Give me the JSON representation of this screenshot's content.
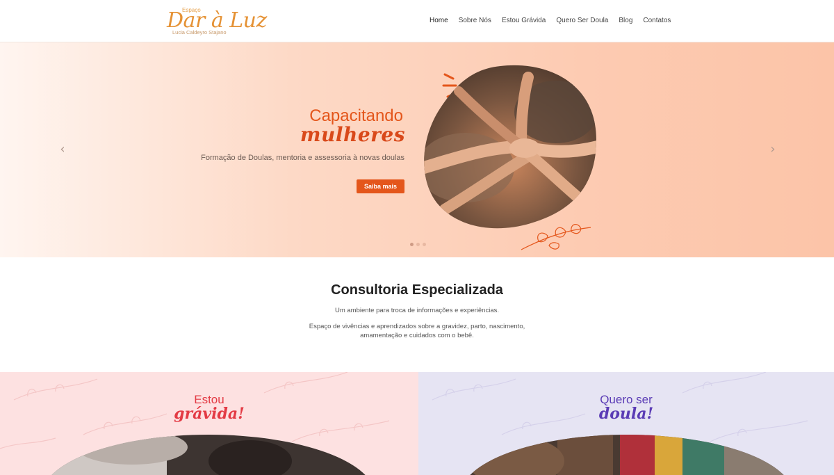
{
  "header": {
    "logo": {
      "small": "Espaço",
      "script": "Dar à Luz",
      "sub": "Lucia Caldeyro Stajano"
    },
    "nav": [
      {
        "label": "Home",
        "active": true
      },
      {
        "label": "Sobre Nós"
      },
      {
        "label": "Estou Grávida"
      },
      {
        "label": "Quero Ser Doula"
      },
      {
        "label": "Blog"
      },
      {
        "label": "Contatos"
      }
    ]
  },
  "hero": {
    "title": "Capacitando",
    "script": "mulheres",
    "description": "Formação de Doulas, mentoria e assessoria à novas doulas",
    "button": "Saiba mais",
    "prev_icon": "chevron-left-icon",
    "next_icon": "chevron-right-icon",
    "slides_total": 3,
    "active_slide": 1,
    "image": "hands-holding-photo"
  },
  "consultoria": {
    "title": "Consultoria Especializada",
    "p1": "Um ambiente para troca de informações e experiências.",
    "p2": "Espaço de vivências e aprendizados sobre a gravidez, parto, nascimento, amamentação e cuidados com o bebê."
  },
  "panels": {
    "left": {
      "line1": "Estou",
      "line2": "grávida!",
      "bg": "#fde1e1",
      "color": "#e33a44"
    },
    "right": {
      "line1": "Quero ser",
      "line2": "doula!",
      "bg": "#e6e4f3",
      "color": "#5a3bb5"
    }
  },
  "colors": {
    "accent": "#e4561b",
    "logo": "#e59235"
  }
}
